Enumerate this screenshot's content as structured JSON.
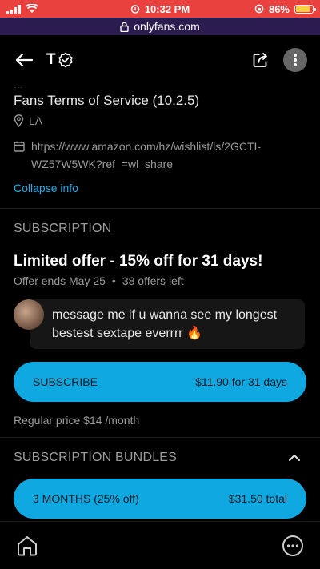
{
  "status_bar": {
    "time": "10:32 PM",
    "battery": "86%",
    "battery_level": 0.86
  },
  "browser": {
    "url": "onlyfans.com"
  },
  "header": {
    "title": "T"
  },
  "info": {
    "cut_text": "...",
    "terms_text": "Fans Terms of Service (10.2.5)",
    "location": "LA",
    "link": "https://www.amazon.com/hz/wishlist/ls/2GCTI-WZ57W5WK?ref_=wl_share",
    "collapse_label": "Collapse info"
  },
  "subscription": {
    "heading": "SUBSCRIPTION",
    "offer_title": "Limited offer - 15% off for 31 days!",
    "offer_ends": "Offer ends May 25",
    "separator": "•",
    "offers_left": "38 offers left",
    "message": "message me if u wanna see my longest bestest sextape everrrr 🔥",
    "subscribe_label": "SUBSCRIBE",
    "subscribe_price": "$11.90 for 31 days",
    "regular_price": "Regular price $14 /month"
  },
  "bundles": {
    "heading": "SUBSCRIPTION BUNDLES",
    "items": [
      {
        "label": "3 MONTHS (25% off)",
        "price": "$31.50 total"
      }
    ]
  },
  "colors": {
    "accent": "#10a8e0",
    "status_bar": "#e8413e",
    "url_bar": "#2a1c4f",
    "link": "#1cadeb"
  },
  "icons": {
    "back": "arrow-left-icon",
    "verified": "verified-badge-icon",
    "share": "share-icon",
    "more": "more-vertical-icon",
    "location": "location-pin-icon",
    "link": "calendar-icon",
    "collapse_section": "chevron-up-icon",
    "home": "home-icon",
    "menu": "more-horizontal-icon"
  }
}
